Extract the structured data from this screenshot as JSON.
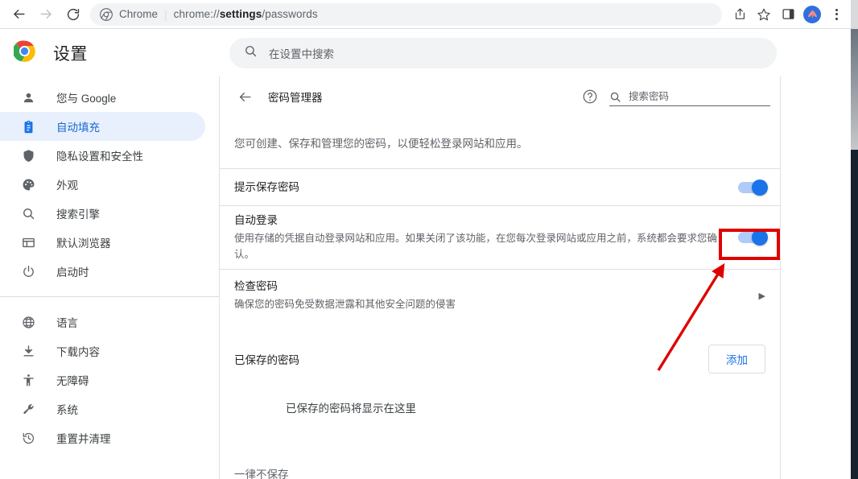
{
  "browser": {
    "nav": {
      "back_icon": "arrow-left-icon",
      "forward_icon": "arrow-right-icon",
      "reload_icon": "reload-icon"
    },
    "omnibox": {
      "app_label": "Chrome",
      "separator": "|",
      "url_prefix": "chrome://",
      "url_bold": "settings",
      "url_suffix": "/passwords",
      "full_url": "chrome://settings/passwords"
    },
    "actions": [
      {
        "name": "share-icon",
        "label": "分享"
      },
      {
        "name": "bookmark-star-icon",
        "label": "收藏"
      },
      {
        "name": "side-panel-icon",
        "label": "侧边栏"
      },
      {
        "name": "profile-avatar",
        "label": "个人资料"
      },
      {
        "name": "more-menu-icon",
        "label": "更多"
      }
    ]
  },
  "settings": {
    "brand_title": "设置",
    "chrome_logo": "chrome-logo-icon",
    "search": {
      "icon": "search-icon",
      "placeholder": "在设置中搜索",
      "value": ""
    }
  },
  "sidebar": {
    "groups": [
      {
        "items": [
          {
            "label": "您与 Google",
            "icon": "person-icon",
            "active": false
          },
          {
            "label": "自动填充",
            "icon": "clipboard-icon",
            "active": true
          },
          {
            "label": "隐私设置和安全性",
            "icon": "shield-icon",
            "active": false
          },
          {
            "label": "外观",
            "icon": "palette-icon",
            "active": false
          },
          {
            "label": "搜索引擎",
            "icon": "search-icon",
            "active": false
          },
          {
            "label": "默认浏览器",
            "icon": "browser-window-icon",
            "active": false
          },
          {
            "label": "启动时",
            "icon": "power-icon",
            "active": false
          }
        ]
      },
      {
        "items": [
          {
            "label": "语言",
            "icon": "globe-icon",
            "active": false
          },
          {
            "label": "下载内容",
            "icon": "download-icon",
            "active": false
          },
          {
            "label": "无障碍",
            "icon": "accessibility-icon",
            "active": false
          },
          {
            "label": "系统",
            "icon": "wrench-icon",
            "active": false
          },
          {
            "label": "重置并清理",
            "icon": "history-restore-icon",
            "active": false
          }
        ]
      }
    ]
  },
  "page": {
    "back_icon": "arrow-left-icon",
    "title": "密码管理器",
    "help_icon": "help-circle-icon",
    "password_search": {
      "icon": "search-icon",
      "placeholder": "搜索密码",
      "value": ""
    },
    "intro": "您可创建、保存和管理您的密码，以便轻松登录网站和应用。",
    "rows": [
      {
        "title": "提示保存密码",
        "sub": "",
        "control": "toggle",
        "toggle_on": true
      },
      {
        "title": "自动登录",
        "sub": "使用存储的凭据自动登录网站和应用。如果关闭了该功能，在您每次登录网站或应用之前，系统都会要求您确认。",
        "control": "toggle",
        "toggle_on": true
      },
      {
        "title": "检查密码",
        "sub": "确保您的密码免受数据泄露和其他安全问题的侵害",
        "control": "chevron",
        "chevron_glyph": "▶"
      }
    ],
    "saved_section": {
      "label": "已保存的密码",
      "add_button": "添加",
      "empty_text": "已保存的密码将显示在这里"
    },
    "never_saved_label": "一律不保存"
  },
  "annotations": {
    "highlight_color": "#e00000",
    "arrow_color": "#e00000",
    "highlight_target": "自动登录 开关",
    "arrow_from": "817,458",
    "arrow_to": "898,330"
  }
}
